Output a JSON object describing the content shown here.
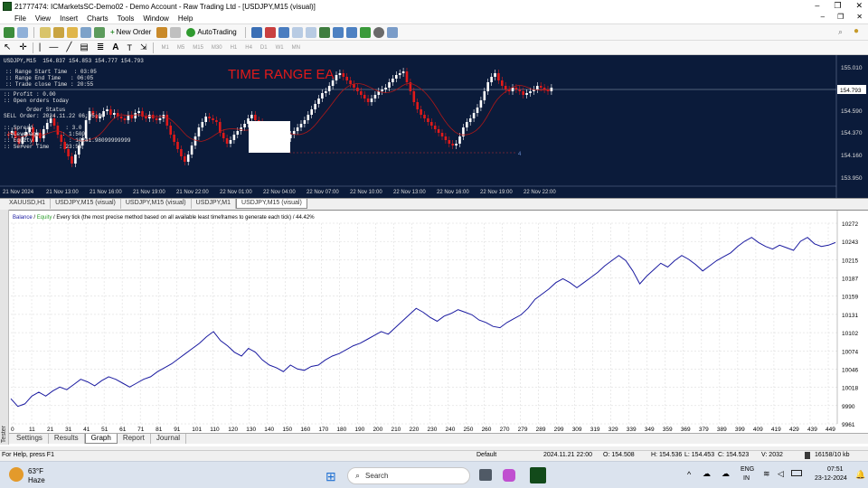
{
  "window": {
    "title": "21777474: ICMarketsSC-Demo02 - Demo Account - Raw Trading Ltd - [USDJPY,M15 (visual)]",
    "controls": [
      "–",
      "❐",
      "✕"
    ]
  },
  "menu": {
    "items": [
      "File",
      "View",
      "Insert",
      "Charts",
      "Tools",
      "Window",
      "Help"
    ],
    "mdi_controls": [
      "–",
      "❐",
      "✕"
    ]
  },
  "toolbar": {
    "new_order": "New Order",
    "autotrading": "AutoTrading",
    "timeframes": [
      "M1",
      "M5",
      "M15",
      "M30",
      "H1",
      "H4",
      "D1",
      "W1",
      "MN"
    ]
  },
  "chart": {
    "symbol_header": "USDJPY,M15  154.837 154.853 154.777 154.793",
    "ea_title": "TIME RANGE EA",
    "ea_title_color": "#e01a1a",
    "info_block_1": ":: Range Start Time  : 03:05\n:: Range End Time   : 06:05\n:: Trade close Time : 20:55",
    "info_block_2": ":: Profit : 0.00\n:: Open orders today",
    "info_block_3": "       Order Status\nSELL Order: 2024.11.22 06:05:00",
    "info_block_4": ":: Spread          : 3.0\n:: Leverage       : 1:500\n:: Equity           : 10241.98099999999\n:: Server Time   : 23:56",
    "price_labels": [
      "155.010",
      "154.793",
      "154.590",
      "154.370",
      "154.160",
      "153.950"
    ],
    "current_price": "154.793",
    "time_labels": [
      "21 Nov 2024",
      "21 Nov 13:00",
      "21 Nov 16:00",
      "21 Nov 19:00",
      "21 Nov 22:00",
      "22 Nov 01:00",
      "22 Nov 04:00",
      "22 Nov 07:00",
      "22 Nov 10:00",
      "22 Nov 13:00",
      "22 Nov 16:00",
      "22 Nov 19:00",
      "22 Nov 22:00"
    ],
    "marker_label": "4",
    "colors": {
      "background": "#0b1b3a",
      "bull": "#ffffff",
      "bear": "#e01a1a",
      "ma": "#b01818"
    }
  },
  "chart_tabs": [
    "XAUUSD,H1",
    "USDJPY,M15 (visual)",
    "USDJPY,M15 (visual)",
    "USDJPY,M1",
    "USDJPY,M15 (visual)"
  ],
  "chart_tabs_active": 4,
  "tester": {
    "side_label": "Tester",
    "legend_balance": "Balance",
    "legend_sep": " / ",
    "legend_equity": "Equity",
    "legend_rest": " / Every tick (the most precise method based on all available least timeframes to generate each tick) / 44.42%",
    "tabs": [
      "Settings",
      "Results",
      "Graph",
      "Report",
      "Journal"
    ],
    "active_tab": "Graph"
  },
  "chart_data": {
    "type": "line",
    "series": [
      {
        "name": "Balance",
        "values": [
          10000,
          9988,
          9992,
          10004,
          10010,
          10004,
          10012,
          10018,
          10014,
          10022,
          10030,
          10026,
          10020,
          10028,
          10034,
          10030,
          10024,
          10018,
          10024,
          10030,
          10034,
          10042,
          10048,
          10054,
          10062,
          10070,
          10078,
          10086,
          10096,
          10104,
          10090,
          10082,
          10072,
          10066,
          10078,
          10072,
          10060,
          10052,
          10048,
          10042,
          10052,
          10046,
          10044,
          10050,
          10052,
          10060,
          10066,
          10070,
          10076,
          10082,
          10086,
          10092,
          10098,
          10104,
          10100,
          10110,
          10120,
          10130,
          10140,
          10134,
          10126,
          10120,
          10128,
          10132,
          10138,
          10134,
          10130,
          10122,
          10118,
          10112,
          10110,
          10118,
          10124,
          10130,
          10140,
          10154,
          10162,
          10170,
          10180,
          10186,
          10180,
          10172,
          10180,
          10188,
          10196,
          10206,
          10214,
          10222,
          10214,
          10198,
          10178,
          10190,
          10200,
          10210,
          10204,
          10214,
          10222,
          10216,
          10208,
          10198,
          10206,
          10214,
          10220,
          10226,
          10236,
          10244,
          10250,
          10242,
          10236,
          10232,
          10238,
          10234,
          10230,
          10244,
          10250,
          10240,
          10236,
          10238,
          10242
        ],
        "color": "#1a1aa0"
      },
      {
        "name": "Equity",
        "color": "#2e9e2e"
      }
    ],
    "x_ticks": [
      "0",
      "11",
      "21",
      "31",
      "41",
      "51",
      "61",
      "71",
      "81",
      "91",
      "101",
      "110",
      "120",
      "130",
      "140",
      "150",
      "160",
      "170",
      "180",
      "190",
      "200",
      "210",
      "220",
      "230",
      "240",
      "250",
      "260",
      "270",
      "279",
      "289",
      "299",
      "309",
      "319",
      "329",
      "339",
      "349",
      "359",
      "369",
      "379",
      "389",
      "399",
      "409",
      "419",
      "429",
      "439",
      "449"
    ],
    "y_ticks": [
      "10272",
      "10243",
      "10215",
      "10187",
      "10159",
      "10131",
      "10102",
      "10074",
      "10046",
      "10018",
      "9990",
      "9961"
    ],
    "ylim": [
      9961,
      10272
    ],
    "grid": true
  },
  "status": {
    "help": "For Help, press F1",
    "profile": "Default",
    "datetime": "2024.11.21 22:00",
    "open": "O: 154.508",
    "high": "H: 154.536",
    "low": "L: 154.453",
    "close": "C: 154.523",
    "volume": "V: 2032",
    "traffic": "16158/10 kb"
  },
  "taskbar": {
    "weather_temp": "63°F",
    "weather_text": "Haze",
    "search": "Search",
    "lang1": "ENG",
    "lang2": "IN",
    "time": "07:51",
    "date": "23-12-2024"
  }
}
